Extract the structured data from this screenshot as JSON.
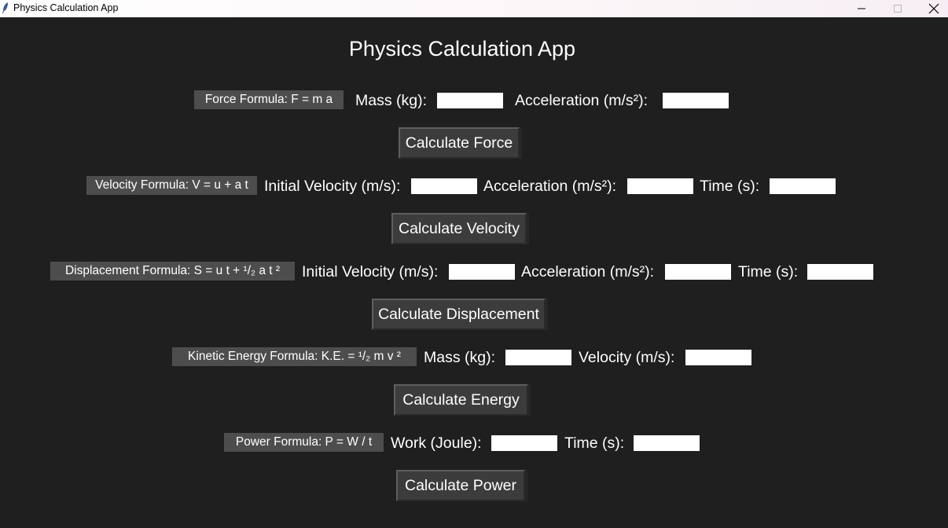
{
  "window": {
    "title": "Physics Calculation App",
    "minimize_icon": "minimize-icon",
    "maximize_icon": "maximize-icon",
    "close_icon": "close-icon"
  },
  "app_title": "Physics Calculation App",
  "colors": {
    "background": "#1f1f1f",
    "formula_label_bg": "#4d4d4d",
    "button_bg": "#3c3c3c",
    "input_bg": "#ffffff",
    "text": "#ffffff"
  },
  "force": {
    "formula": "Force Formula: F = m a",
    "mass_label": "Mass (kg):",
    "mass_value": "",
    "acceleration_label": "Acceleration (m/s²):",
    "acceleration_value": "",
    "button": "Calculate Force"
  },
  "velocity": {
    "formula": "Velocity Formula: V = u + a t",
    "initial_velocity_label": "Initial Velocity (m/s):",
    "initial_velocity_value": "",
    "acceleration_label": "Acceleration (m/s²):",
    "acceleration_value": "",
    "time_label": "Time (s):",
    "time_value": "",
    "button": "Calculate Velocity"
  },
  "displacement": {
    "formula": "Displacement Formula: S = u t + ¹/₂ a t ²",
    "initial_velocity_label": "Initial Velocity (m/s):",
    "initial_velocity_value": "",
    "acceleration_label": "Acceleration (m/s²):",
    "acceleration_value": "",
    "time_label": "Time (s):",
    "time_value": "",
    "button": "Calculate Displacement"
  },
  "kinetic_energy": {
    "formula": "Kinetic Energy Formula: K.E. = ¹/₂ m v ²",
    "mass_label": "Mass (kg):",
    "mass_value": "",
    "velocity_label": "Velocity (m/s):",
    "velocity_value": "",
    "button": "Calculate Energy"
  },
  "power": {
    "formula": "Power Formula: P = W / t",
    "work_label": "Work (Joule):",
    "work_value": "",
    "time_label": "Time (s):",
    "time_value": "",
    "button": "Calculate Power"
  }
}
